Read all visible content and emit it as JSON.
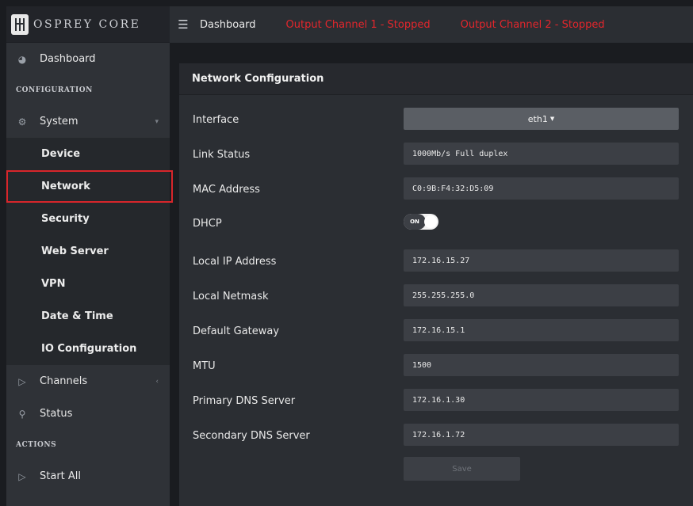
{
  "brand": {
    "name": "OSPREY CORE"
  },
  "topbar": {
    "menu_icon": "hamburger-icon",
    "breadcrumb": "Dashboard",
    "status_1": "Output Channel 1 - Stopped",
    "status_2": "Output Channel 2 - Stopped",
    "status_color": "#e3262c"
  },
  "sidebar": {
    "dashboard": {
      "label": "Dashboard",
      "icon": "gauge-icon"
    },
    "configuration_heading": "CONFIGURATION",
    "system": {
      "label": "System",
      "icon": "gear-icon"
    },
    "sub_items": [
      {
        "label": "Device"
      },
      {
        "label": "Network",
        "highlighted": true
      },
      {
        "label": "Security"
      },
      {
        "label": "Web Server"
      },
      {
        "label": "VPN"
      },
      {
        "label": "Date & Time"
      },
      {
        "label": "IO Configuration"
      }
    ],
    "channels": {
      "label": "Channels",
      "icon": "video-icon"
    },
    "status": {
      "label": "Status",
      "icon": "search-icon"
    },
    "actions_heading": "ACTIONS",
    "start_all": {
      "label": "Start All",
      "icon": "play-icon"
    }
  },
  "panel": {
    "title": "Network Configuration",
    "interface": {
      "label": "Interface",
      "value": "eth1"
    },
    "link_status": {
      "label": "Link Status",
      "value": "1000Mb/s Full duplex"
    },
    "mac_address": {
      "label": "MAC Address",
      "value": "C0:9B:F4:32:D5:09"
    },
    "dhcp": {
      "label": "DHCP",
      "value": "ON"
    },
    "local_ip": {
      "label": "Local IP Address",
      "value": "172.16.15.27"
    },
    "netmask": {
      "label": "Local Netmask",
      "value": "255.255.255.0"
    },
    "gateway": {
      "label": "Default Gateway",
      "value": "172.16.15.1"
    },
    "mtu": {
      "label": "MTU",
      "value": "1500"
    },
    "primary_dns": {
      "label": "Primary DNS Server",
      "value": "172.16.1.30"
    },
    "secondary_dns": {
      "label": "Secondary DNS Server",
      "value": "172.16.1.72"
    },
    "save_label": "Save"
  }
}
